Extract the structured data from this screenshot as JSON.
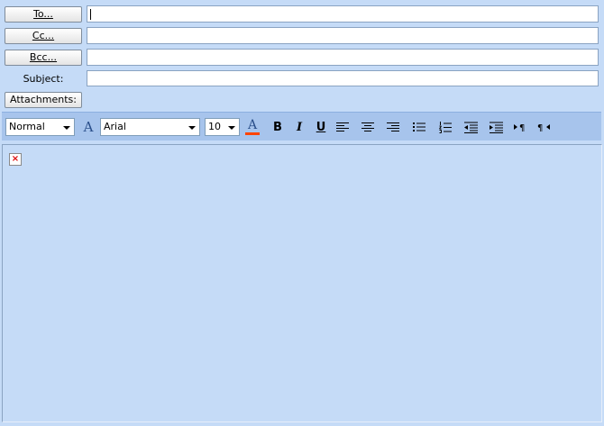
{
  "header": {
    "to_label": "To...",
    "cc_label": "Cc...",
    "bcc_label": "Bcc...",
    "subject_label": "Subject:",
    "attachments_label": "Attachments:",
    "to_value": "",
    "cc_value": "",
    "bcc_value": "",
    "subject_value": ""
  },
  "toolbar": {
    "style_value": "Normal",
    "font_value": "Arial",
    "size_value": "10",
    "bold_label": "B",
    "italic_label": "I",
    "underline_label": "U",
    "font_color": "#ff4400",
    "icons": [
      "font-style-icon",
      "font-color-icon",
      "bold-icon",
      "italic-icon",
      "underline-icon",
      "align-left-icon",
      "align-center-icon",
      "align-right-icon",
      "bullet-list-icon",
      "numbered-list-icon",
      "decrease-indent-icon",
      "increase-indent-icon",
      "ltr-icon",
      "rtl-icon"
    ]
  },
  "colors": {
    "background": "#c5dbf7",
    "toolbar": "#a7c4ec"
  }
}
